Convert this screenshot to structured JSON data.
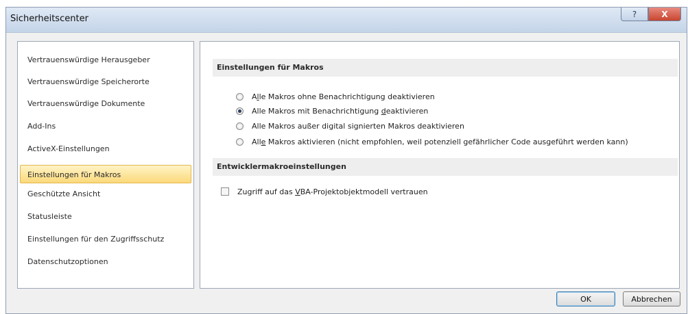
{
  "window": {
    "title": "Sicherheitscenter",
    "help_glyph": "?",
    "close_glyph": "X"
  },
  "sidebar": {
    "items": [
      {
        "label": "Vertrauenswürdige Herausgeber",
        "selected": false
      },
      {
        "label": "Vertrauenswürdige Speicherorte",
        "selected": false
      },
      {
        "label": "Vertrauenswürdige Dokumente",
        "selected": false
      },
      {
        "label": "Add-Ins",
        "selected": false
      },
      {
        "label": "ActiveX-Einstellungen",
        "selected": false
      },
      {
        "label": "Einstellungen für Makros",
        "selected": true
      },
      {
        "label": "Geschützte Ansicht",
        "selected": false
      },
      {
        "label": "Statusleiste",
        "selected": false
      },
      {
        "label": "Einstellungen für den Zugriffsschutz",
        "selected": false
      },
      {
        "label": "Datenschutzoptionen",
        "selected": false
      }
    ]
  },
  "macro_settings": {
    "header": "Einstellungen für Makros",
    "options": [
      {
        "pre": "A",
        "access": "l",
        "post": "le Makros ohne Benachrichtigung deaktivieren",
        "checked": false
      },
      {
        "pre": "Alle Makros mit Benachrichtigung ",
        "access": "d",
        "post": "eaktivieren",
        "checked": true
      },
      {
        "pre": "Alle Makros außer digital signierten Makros deaktivieren",
        "access": "",
        "post": "",
        "checked": false
      },
      {
        "pre": "All",
        "access": "e",
        "post": " Makros aktivieren (nicht empfohlen, weil potenziell gefährlicher Code ausgeführt werden kann)",
        "checked": false
      }
    ]
  },
  "developer_settings": {
    "header": "Entwicklermakroeinstellungen",
    "checkbox": {
      "pre": "Zugriff auf das ",
      "access": "V",
      "post": "BA-Projektobjektmodell vertrauen",
      "checked": false
    }
  },
  "buttons": {
    "ok": "OK",
    "cancel": "Abbrechen"
  }
}
